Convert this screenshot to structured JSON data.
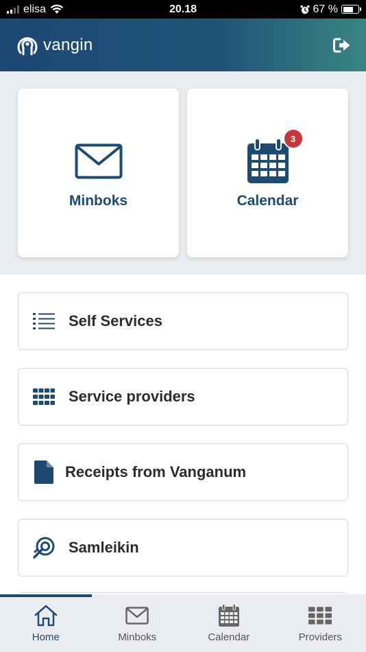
{
  "status_bar": {
    "carrier": "elisa",
    "time": "20.18",
    "battery_percent": "67 %",
    "battery_level": 0.67
  },
  "header": {
    "logo_text": "vangin",
    "logout_icon": "logout-icon"
  },
  "tiles": [
    {
      "label": "Minboks",
      "icon": "envelope-icon"
    },
    {
      "label": "Calendar",
      "icon": "calendar-icon",
      "badge": "3"
    }
  ],
  "menu": [
    {
      "label": "Self Services",
      "icon": "list-icon"
    },
    {
      "label": "Service providers",
      "icon": "grid-icon"
    },
    {
      "label": "Receipts from Vanganum",
      "icon": "document-icon"
    },
    {
      "label": "Samleikin",
      "icon": "samleikin-icon"
    }
  ],
  "bottom_nav": [
    {
      "label": "Home",
      "icon": "home-icon",
      "active": true
    },
    {
      "label": "Minboks",
      "icon": "envelope-icon"
    },
    {
      "label": "Calendar",
      "icon": "calendar-icon"
    },
    {
      "label": "Providers",
      "icon": "grid-icon"
    }
  ],
  "colors": {
    "brand": "#1c4873",
    "header_gradient_end": "#3a8583",
    "badge": "#c5373a",
    "tile_area_bg": "#e9edf0"
  }
}
